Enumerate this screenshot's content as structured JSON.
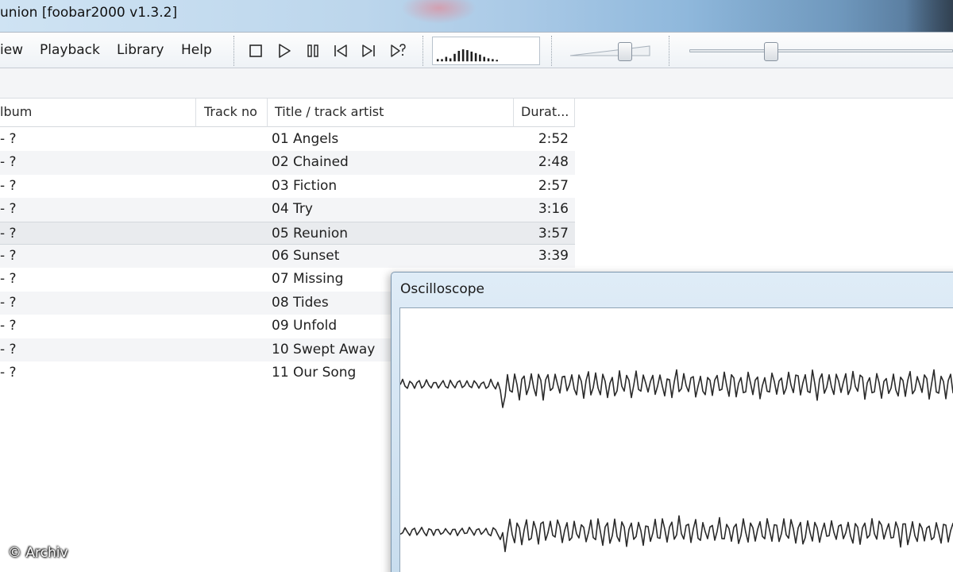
{
  "window": {
    "title": "union  [foobar2000 v1.3.2]"
  },
  "menu": {
    "items": [
      "iew",
      "Playback",
      "Library",
      "Help"
    ]
  },
  "toolbar": {
    "buttons": [
      "stop-icon",
      "play-icon",
      "pause-icon",
      "previous-icon",
      "next-icon",
      "random-icon"
    ],
    "volume_level": 0.72,
    "seek_position": 0.3
  },
  "playlist": {
    "columns": [
      "lbum",
      "Track no",
      "Title / track artist",
      "Durat..."
    ],
    "rows": [
      {
        "album": "- ?",
        "title": "01 Angels",
        "duration": "2:52"
      },
      {
        "album": "- ?",
        "title": "02 Chained",
        "duration": "2:48"
      },
      {
        "album": "- ?",
        "title": "03 Fiction",
        "duration": "2:57"
      },
      {
        "album": "- ?",
        "title": "04 Try",
        "duration": "3:16"
      },
      {
        "album": "- ?",
        "title": "05 Reunion",
        "duration": "3:57"
      },
      {
        "album": "- ?",
        "title": "06 Sunset",
        "duration": "3:39"
      },
      {
        "album": "- ?",
        "title": "07 Missing",
        "duration": ""
      },
      {
        "album": "- ?",
        "title": "08 Tides",
        "duration": ""
      },
      {
        "album": "- ?",
        "title": "09 Unfold",
        "duration": ""
      },
      {
        "album": "- ?",
        "title": "10 Swept Away",
        "duration": ""
      },
      {
        "album": "- ?",
        "title": "11 Our Song",
        "duration": ""
      }
    ],
    "selected_index": 4
  },
  "oscilloscope": {
    "title": "Oscilloscope"
  },
  "watermark": "© Archiv"
}
